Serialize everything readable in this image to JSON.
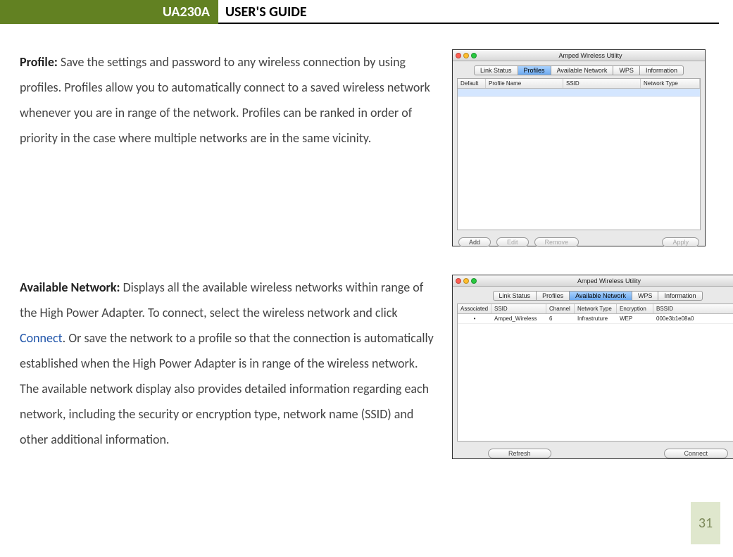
{
  "header": {
    "model": "UA230A",
    "title": "USER'S GUIDE"
  },
  "section1": {
    "label": "Profile:",
    "body": " Save the settings and password to any wireless connection by using profiles. Profiles allow you to automatically connect to a saved wireless network whenever you are in range of the network. Profiles can be ranked in order of priority in the case where multiple networks are in the same vicinity."
  },
  "section2": {
    "label": "Available Network:",
    "body_a": " Displays all the available wireless networks within range of the High Power Adapter. To connect, select the wireless network and click ",
    "link": "Connect",
    "body_b": ". Or save the network to a profile so that the connection is automatically established when the High Power Adapter is in range of the wireless network. The available network display also provides detailed information regarding each network, including the security or encryption type, network name (SSID) and other additional information."
  },
  "shot_common": {
    "window_title": "Amped Wireless Utility"
  },
  "shot1": {
    "tabs": [
      "Link Status",
      "Profiles",
      "Available Network",
      "WPS",
      "Information"
    ],
    "active_tab": 1,
    "columns": {
      "c1": "Default",
      "c2": "Profile Name",
      "c3": "SSID",
      "c4": "Network Type"
    },
    "buttons": {
      "add": "Add",
      "edit": "Edit",
      "remove": "Remove",
      "apply": "Apply"
    }
  },
  "shot2": {
    "tabs": [
      "Link Status",
      "Profiles",
      "Available Network",
      "WPS",
      "Information"
    ],
    "active_tab": 2,
    "columns": {
      "c1": "Associated",
      "c2": "SSID",
      "c3": "Channel",
      "c4": "Network Type",
      "c5": "Encryption",
      "c6": "BSSID"
    },
    "row": {
      "c1": "•",
      "c2": "Amped_Wireless",
      "c3": "6",
      "c4": "Infrastruture",
      "c5": "WEP",
      "c6": "000e3b1e08a0"
    },
    "buttons": {
      "refresh": "Refresh",
      "connect": "Connect"
    }
  },
  "page_number": "31"
}
